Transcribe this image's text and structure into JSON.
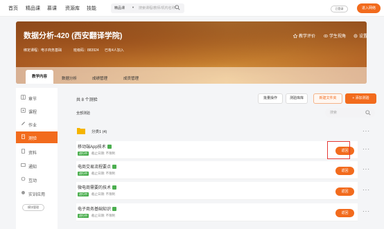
{
  "topnav": {
    "items": [
      "首页",
      "精品课",
      "慕课",
      "资源库",
      "技能"
    ],
    "search": {
      "category": "精品课",
      "placeholder": "搜索课程/教师/机构名称"
    },
    "status_pill": "已登录",
    "enter_button": "进入网络"
  },
  "banner": {
    "title": "数据分析-420 (西安翻译学院)",
    "meta": {
      "course_label": "绑定课程：电子商务基础",
      "class_label": "班级码：883924",
      "joined": "已有4人加入"
    },
    "actions": [
      "教学评价",
      "学生视角",
      "设置"
    ],
    "tabs": [
      "教学内容",
      "数据分析",
      "成绩管理",
      "成员管理"
    ]
  },
  "sidebar": {
    "items": [
      "章节",
      "课程",
      "作业",
      "测验",
      "资料",
      "通知",
      "互动",
      "实训应用"
    ],
    "active_index": 3,
    "manage_label": "模块管理"
  },
  "main": {
    "count_text": "共 8 个测验",
    "all_label": "全部测验",
    "buttons": [
      "批量操作",
      "测验库库",
      "新建文件夹",
      "+ 添加测验"
    ],
    "search_placeholder": "搜索",
    "group": {
      "label": "分类1 (4)"
    },
    "items": [
      {
        "title": "移动端App技术",
        "status": "进行中",
        "time": "截止日期: 不限制",
        "button": "返回"
      },
      {
        "title": "电商交易流程要点",
        "status": "进行中",
        "time": "截止日期: 不限制",
        "button": "返回"
      },
      {
        "title": "微电商需要的技术",
        "status": "进行中",
        "time": "截止日期: 不限制",
        "button": "返回"
      },
      {
        "title": "电子商务基础知识",
        "status": "进行中",
        "time": "截止日期: 不限制",
        "button": "返回"
      }
    ]
  },
  "colors": {
    "accent": "#f26b1d",
    "status_green": "#4caf50",
    "highlight": "#e53935"
  }
}
